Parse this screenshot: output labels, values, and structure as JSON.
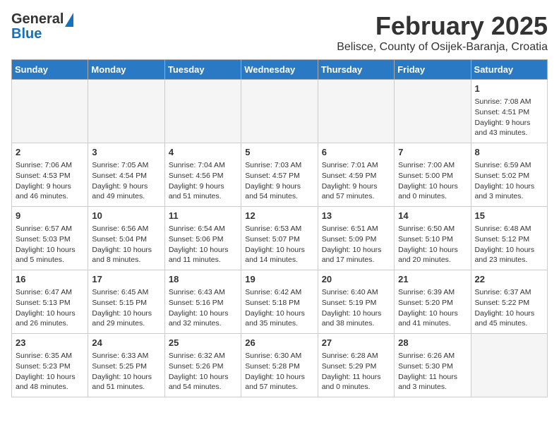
{
  "header": {
    "logo_general": "General",
    "logo_blue": "Blue",
    "title": "February 2025",
    "subtitle": "Belisce, County of Osijek-Baranja, Croatia"
  },
  "weekdays": [
    "Sunday",
    "Monday",
    "Tuesday",
    "Wednesday",
    "Thursday",
    "Friday",
    "Saturday"
  ],
  "weeks": [
    [
      {
        "day": "",
        "info": ""
      },
      {
        "day": "",
        "info": ""
      },
      {
        "day": "",
        "info": ""
      },
      {
        "day": "",
        "info": ""
      },
      {
        "day": "",
        "info": ""
      },
      {
        "day": "",
        "info": ""
      },
      {
        "day": "1",
        "info": "Sunrise: 7:08 AM\nSunset: 4:51 PM\nDaylight: 9 hours and 43 minutes."
      }
    ],
    [
      {
        "day": "2",
        "info": "Sunrise: 7:06 AM\nSunset: 4:53 PM\nDaylight: 9 hours and 46 minutes."
      },
      {
        "day": "3",
        "info": "Sunrise: 7:05 AM\nSunset: 4:54 PM\nDaylight: 9 hours and 49 minutes."
      },
      {
        "day": "4",
        "info": "Sunrise: 7:04 AM\nSunset: 4:56 PM\nDaylight: 9 hours and 51 minutes."
      },
      {
        "day": "5",
        "info": "Sunrise: 7:03 AM\nSunset: 4:57 PM\nDaylight: 9 hours and 54 minutes."
      },
      {
        "day": "6",
        "info": "Sunrise: 7:01 AM\nSunset: 4:59 PM\nDaylight: 9 hours and 57 minutes."
      },
      {
        "day": "7",
        "info": "Sunrise: 7:00 AM\nSunset: 5:00 PM\nDaylight: 10 hours and 0 minutes."
      },
      {
        "day": "8",
        "info": "Sunrise: 6:59 AM\nSunset: 5:02 PM\nDaylight: 10 hours and 3 minutes."
      }
    ],
    [
      {
        "day": "9",
        "info": "Sunrise: 6:57 AM\nSunset: 5:03 PM\nDaylight: 10 hours and 5 minutes."
      },
      {
        "day": "10",
        "info": "Sunrise: 6:56 AM\nSunset: 5:04 PM\nDaylight: 10 hours and 8 minutes."
      },
      {
        "day": "11",
        "info": "Sunrise: 6:54 AM\nSunset: 5:06 PM\nDaylight: 10 hours and 11 minutes."
      },
      {
        "day": "12",
        "info": "Sunrise: 6:53 AM\nSunset: 5:07 PM\nDaylight: 10 hours and 14 minutes."
      },
      {
        "day": "13",
        "info": "Sunrise: 6:51 AM\nSunset: 5:09 PM\nDaylight: 10 hours and 17 minutes."
      },
      {
        "day": "14",
        "info": "Sunrise: 6:50 AM\nSunset: 5:10 PM\nDaylight: 10 hours and 20 minutes."
      },
      {
        "day": "15",
        "info": "Sunrise: 6:48 AM\nSunset: 5:12 PM\nDaylight: 10 hours and 23 minutes."
      }
    ],
    [
      {
        "day": "16",
        "info": "Sunrise: 6:47 AM\nSunset: 5:13 PM\nDaylight: 10 hours and 26 minutes."
      },
      {
        "day": "17",
        "info": "Sunrise: 6:45 AM\nSunset: 5:15 PM\nDaylight: 10 hours and 29 minutes."
      },
      {
        "day": "18",
        "info": "Sunrise: 6:43 AM\nSunset: 5:16 PM\nDaylight: 10 hours and 32 minutes."
      },
      {
        "day": "19",
        "info": "Sunrise: 6:42 AM\nSunset: 5:18 PM\nDaylight: 10 hours and 35 minutes."
      },
      {
        "day": "20",
        "info": "Sunrise: 6:40 AM\nSunset: 5:19 PM\nDaylight: 10 hours and 38 minutes."
      },
      {
        "day": "21",
        "info": "Sunrise: 6:39 AM\nSunset: 5:20 PM\nDaylight: 10 hours and 41 minutes."
      },
      {
        "day": "22",
        "info": "Sunrise: 6:37 AM\nSunset: 5:22 PM\nDaylight: 10 hours and 45 minutes."
      }
    ],
    [
      {
        "day": "23",
        "info": "Sunrise: 6:35 AM\nSunset: 5:23 PM\nDaylight: 10 hours and 48 minutes."
      },
      {
        "day": "24",
        "info": "Sunrise: 6:33 AM\nSunset: 5:25 PM\nDaylight: 10 hours and 51 minutes."
      },
      {
        "day": "25",
        "info": "Sunrise: 6:32 AM\nSunset: 5:26 PM\nDaylight: 10 hours and 54 minutes."
      },
      {
        "day": "26",
        "info": "Sunrise: 6:30 AM\nSunset: 5:28 PM\nDaylight: 10 hours and 57 minutes."
      },
      {
        "day": "27",
        "info": "Sunrise: 6:28 AM\nSunset: 5:29 PM\nDaylight: 11 hours and 0 minutes."
      },
      {
        "day": "28",
        "info": "Sunrise: 6:26 AM\nSunset: 5:30 PM\nDaylight: 11 hours and 3 minutes."
      },
      {
        "day": "",
        "info": ""
      }
    ]
  ]
}
